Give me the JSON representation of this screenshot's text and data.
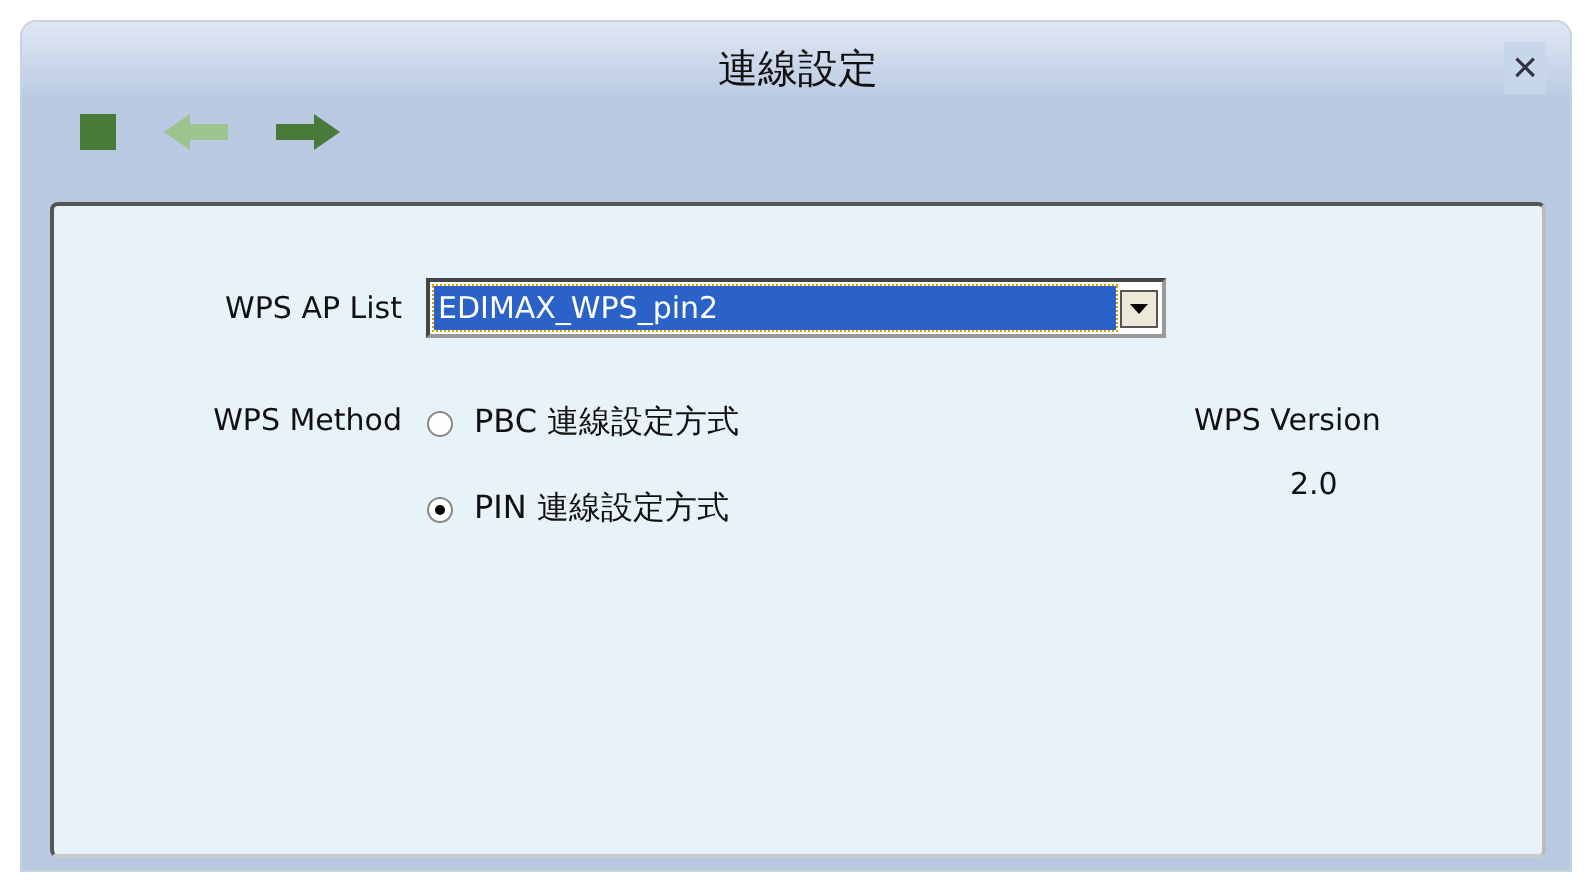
{
  "window": {
    "title": "連線設定",
    "close": "×"
  },
  "toolbar": [
    {
      "kind": "stop",
      "disabled": false
    },
    {
      "kind": "back",
      "disabled": true
    },
    {
      "kind": "forward",
      "disabled": false
    }
  ],
  "ap_list": {
    "label": "WPS AP List",
    "value": "EDIMAX_WPS_pin2"
  },
  "method": {
    "label": "WPS Method",
    "options": [
      {
        "label": "PBC 連線設定方式",
        "selected": false
      },
      {
        "label": "PIN 連線設定方式",
        "selected": true
      }
    ]
  },
  "version": {
    "label": "WPS Version",
    "value": "2.0"
  }
}
